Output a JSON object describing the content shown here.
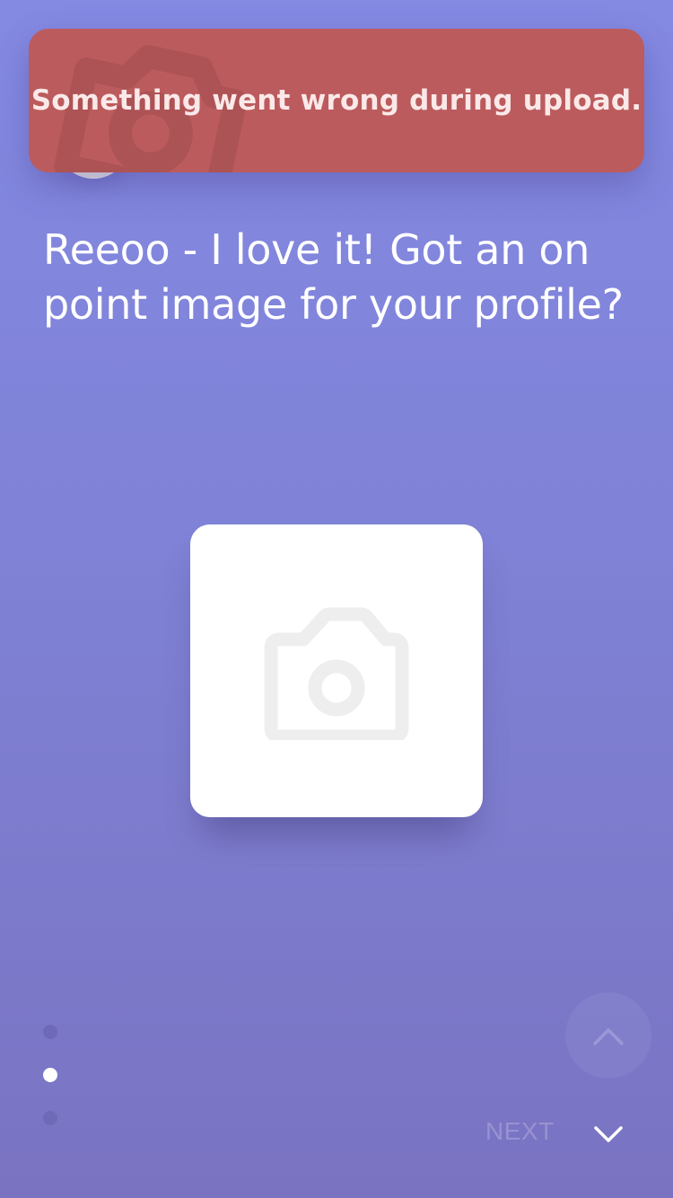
{
  "toast": {
    "message": "Something went wrong during upload.",
    "color": "#bc5b5d"
  },
  "prompt": {
    "line1": "Reeoo - I love it! Got an on",
    "line2": "point image for your profile?"
  },
  "upload": {
    "icon": "camera-icon"
  },
  "pagination": {
    "total": 3,
    "active_index": 1
  },
  "navigation": {
    "next_label": "NEXT",
    "up_icon": "chevron-up-icon",
    "down_icon": "chevron-down-icon"
  },
  "colors": {
    "background_top": "#8489e2",
    "background_bottom": "#7a73c2",
    "accent": "#ffffff"
  }
}
